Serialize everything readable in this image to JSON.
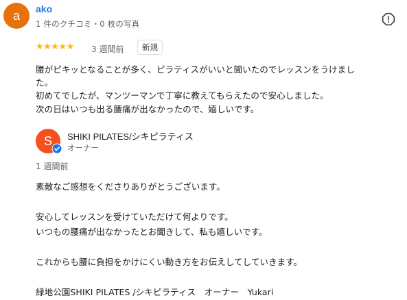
{
  "reviewer": {
    "initial": "a",
    "name": "ako",
    "meta": "1 件のクチコミ・0 枚の写真",
    "avatar_color": "#e8710a"
  },
  "rating": {
    "stars": "★★★★★",
    "value": 5,
    "max": 5,
    "time": "3 週間前",
    "badge": "新規"
  },
  "review_lines": [
    "腰がピキッとなることが多く、ピラティスがいいと聞いたのでレッスンをうけまし",
    "た。",
    "初めてでしたが、マンツーマンで丁寧に教えてもらえたので安心しました。",
    "次の日はいつも出る腰痛が出なかったので、嬉しいです。"
  ],
  "owner": {
    "initial": "S",
    "name": "SHIKI PILATES/シキピラティス",
    "role": "オーナー",
    "avatar_color": "#f4511e",
    "verified_color": "#1a73e8"
  },
  "reply": {
    "time": "1 週間前",
    "lines": [
      "素敵なご感想をくださりありがとうございます。",
      "",
      "安心してレッスンを受けていただけて何よりです。",
      "いつもの腰痛が出なかったとお聞きして、私も嬉しいです。",
      "",
      "これからも腰に負担をかけにくい動き方をお伝えしてしていきます。",
      "",
      "緑地公園SHIKI PILATES /シキピラティス　オーナー　Yukari"
    ]
  }
}
